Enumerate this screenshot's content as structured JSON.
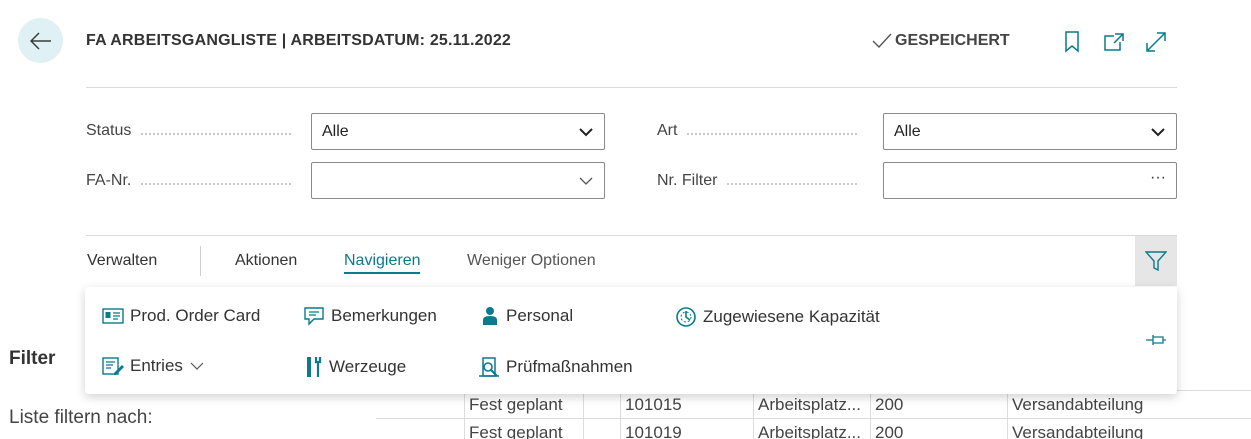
{
  "header": {
    "title": "FA ARBEITSGANGLISTE | ARBEITSDATUM: 25.11.2022",
    "saved_label": "GESPEICHERT"
  },
  "filters": {
    "status": {
      "label": "Status",
      "value": "Alle"
    },
    "art": {
      "label": "Art",
      "value": "Alle"
    },
    "fa_nr": {
      "label": "FA-Nr.",
      "value": ""
    },
    "nr_filter": {
      "label": "Nr. Filter",
      "value": "",
      "more": "···"
    }
  },
  "actions": {
    "tabs": [
      {
        "label": "Verwalten"
      },
      {
        "label": "Aktionen"
      },
      {
        "label": "Navigieren"
      },
      {
        "label": "Weniger Optionen"
      }
    ]
  },
  "navigate_menu": {
    "items": [
      {
        "label": "Prod. Order Card",
        "icon": "card-icon"
      },
      {
        "label": "Bemerkungen",
        "icon": "comment-icon"
      },
      {
        "label": "Personal",
        "icon": "person-icon"
      },
      {
        "label": "Zugewiesene Kapazität",
        "icon": "capacity-icon"
      },
      {
        "label": "Entries",
        "icon": "entries-icon"
      },
      {
        "label": "Werzeuge",
        "icon": "tools-icon"
      },
      {
        "label": "Prüfmaßnahmen",
        "icon": "inspection-icon"
      }
    ]
  },
  "filter_pane": {
    "heading": "Filter",
    "filter_by": "Liste filtern nach:"
  },
  "grid": {
    "rows": [
      [
        "Fest geplant",
        "",
        "101015",
        "Arbeitsplatz...",
        "200",
        "Versandabteilung"
      ],
      [
        "Fest geplant",
        "",
        "101019",
        "Arbeitsplatz...",
        "200",
        "Versandabteilung"
      ]
    ]
  },
  "colors": {
    "accent": "#0a7a8c",
    "back_button_bg": "#dff1f4"
  }
}
